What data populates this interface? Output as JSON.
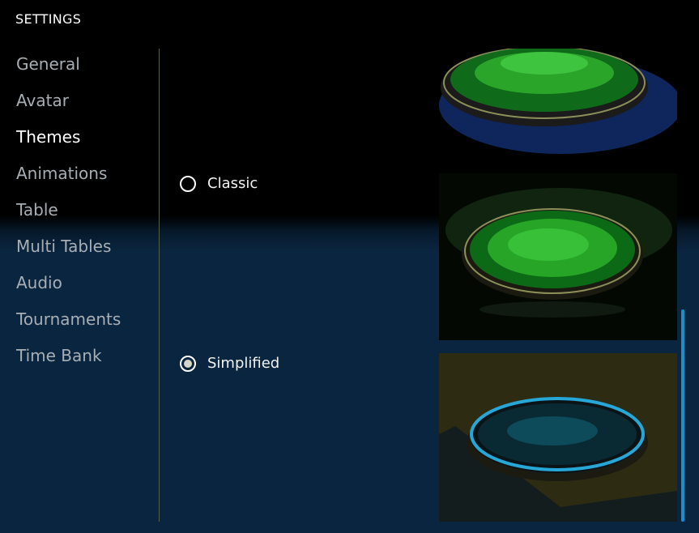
{
  "header": {
    "title": "SETTINGS"
  },
  "sidebar": {
    "items": [
      {
        "label": "General"
      },
      {
        "label": "Avatar"
      },
      {
        "label": "Themes"
      },
      {
        "label": "Animations"
      },
      {
        "label": "Table"
      },
      {
        "label": "Multi Tables"
      },
      {
        "label": "Audio"
      },
      {
        "label": "Tournaments"
      },
      {
        "label": "Time Bank"
      }
    ],
    "active": "Themes"
  },
  "themes": {
    "options": [
      {
        "label": "Classic",
        "selected": false
      },
      {
        "label": "Simplified",
        "selected": true
      }
    ]
  },
  "colors": {
    "accent": "#1a8fc8",
    "felt_green": "#1f8f1f",
    "background": "#0a2540"
  }
}
